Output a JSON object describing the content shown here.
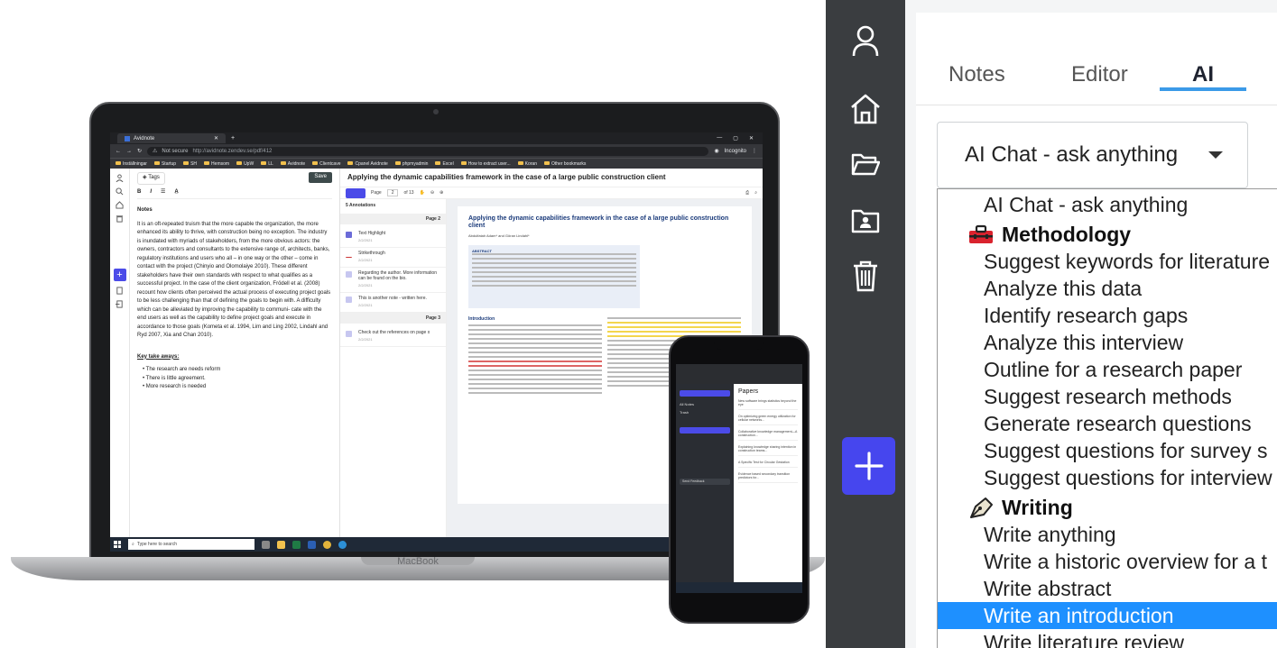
{
  "laptop": {
    "brand": "MacBook",
    "browser": {
      "tab_title": "Avidnote",
      "url_security": "Not secure",
      "url": "http://avidnote.zendev.se/pdf/412",
      "profile": "Incognito",
      "bookmarks": [
        "Inställningar",
        "Startup",
        "SH",
        "Hemsom",
        "UpW",
        "LL",
        "Avidnote",
        "Clientcave",
        "Cpanel Avidnote",
        "phpmyadmin",
        "Excel",
        "How to extract user...",
        "Koran",
        "Other bookmarks"
      ]
    },
    "notes": {
      "tags_label": "Tags",
      "save_label": "Save",
      "heading": "Notes",
      "body": "It is an oft-repeated truism that the more capable the organization, the more enhanced its ability to thrive, with construction being no exception. The industry is inundated with myriads of stakeholders, from the more obvious actors: the owners, contractors and consultants to the extensive range of, architects, banks, regulatory institutions and users who all – in one way or the other – come in contact with the project (Chinyio and Olomolaiye 2010). These different stakeholders have their own standards with respect to what qualifies as a successful project. In the case of the client organization, Frödell et al. (2008) recount how clients often perceived the actual process of executing project goals to be less challenging than that of defining the goals to begin with. A difficulty which can be alleviated by improving the capability to communi- cate with the end users as well as the capability to define project goals and execute in accordance to those goals (Kometa et al. 1994, Lim and Ling 2002, Lindahl and Ryd 2007, Xia and Chan 2010).",
      "key_heading": "Key take aways:",
      "bullets": [
        "The research are needs reform",
        "There is little agreement.",
        "More research is needed"
      ]
    },
    "pdf": {
      "title": "Applying the dynamic capabilities framework in the case of a large public construction client",
      "page_label": "Page",
      "page_current": "2",
      "page_total": "of 13",
      "annotations_heading": "5 Annotations",
      "page2_label": "Page 2",
      "page3_label": "Page 3",
      "annotations": [
        {
          "text": "Text Highlight",
          "date": "2/2/2021"
        },
        {
          "text": "Strikethrough",
          "date": "2/2/2021"
        },
        {
          "text": "Regarding the author. More information can be found on the bio.",
          "date": "2/2/2021"
        },
        {
          "text": "This is another note - written here.",
          "date": "2/2/2021"
        }
      ],
      "annotation_page3": {
        "text": "Check out the references on page x",
        "date": "2/2/2021"
      },
      "paper_title": "Applying the dynamic capabilities framework in the case of a large public construction client",
      "paper_authors": "Abdulfatah Adam* and Göran Lindahl*",
      "abstract_label": "ABSTRACT",
      "intro_label": "Introduction"
    },
    "taskbar": {
      "search_placeholder": "Type here to search"
    }
  },
  "phone": {
    "papers_heading": "Papers",
    "menu_items": [
      "All Notes",
      "Trash"
    ],
    "papers": [
      "New software brings statistics beyond the eye",
      "On optimizing green energy utilization for cellular networks...",
      "Collaborative knowledge management—A construction...",
      "Explaining knowledge sharing intention in construction teams...",
      "A Specific Test for Circular Gestation",
      "Evidence based secondary transition predictors for..."
    ],
    "feedback_label": "Send Feedback"
  },
  "rail": {
    "icons": [
      "user-icon",
      "home-icon",
      "folder-open-icon",
      "folder-user-icon",
      "trash-icon"
    ],
    "add_icon": "plus-icon"
  },
  "panel": {
    "tabs": [
      {
        "label": "Notes",
        "active": false
      },
      {
        "label": "Editor",
        "active": false
      },
      {
        "label": "AI",
        "active": true
      }
    ],
    "select_value": "AI Chat - ask anything",
    "dropdown": {
      "top_option": "AI Chat - ask anything",
      "group_methodology": "Methodology",
      "methodology_items": [
        "Suggest keywords for literature",
        "Analyze this data",
        "Identify research gaps",
        "Analyze this interview",
        "Outline for a research paper",
        "Suggest research methods",
        "Generate research questions",
        "Suggest questions for survey s",
        "Suggest questions for interview"
      ],
      "group_writing": "Writing",
      "writing_items": [
        "Write anything",
        "Write a historic overview for a t",
        "Write abstract",
        "Write an introduction",
        "Write literature review"
      ],
      "selected_item": "Write an introduction"
    },
    "accent_color": "#3b9ae8",
    "selected_color": "#1e90ff",
    "add_button_color": "#4646ee"
  }
}
